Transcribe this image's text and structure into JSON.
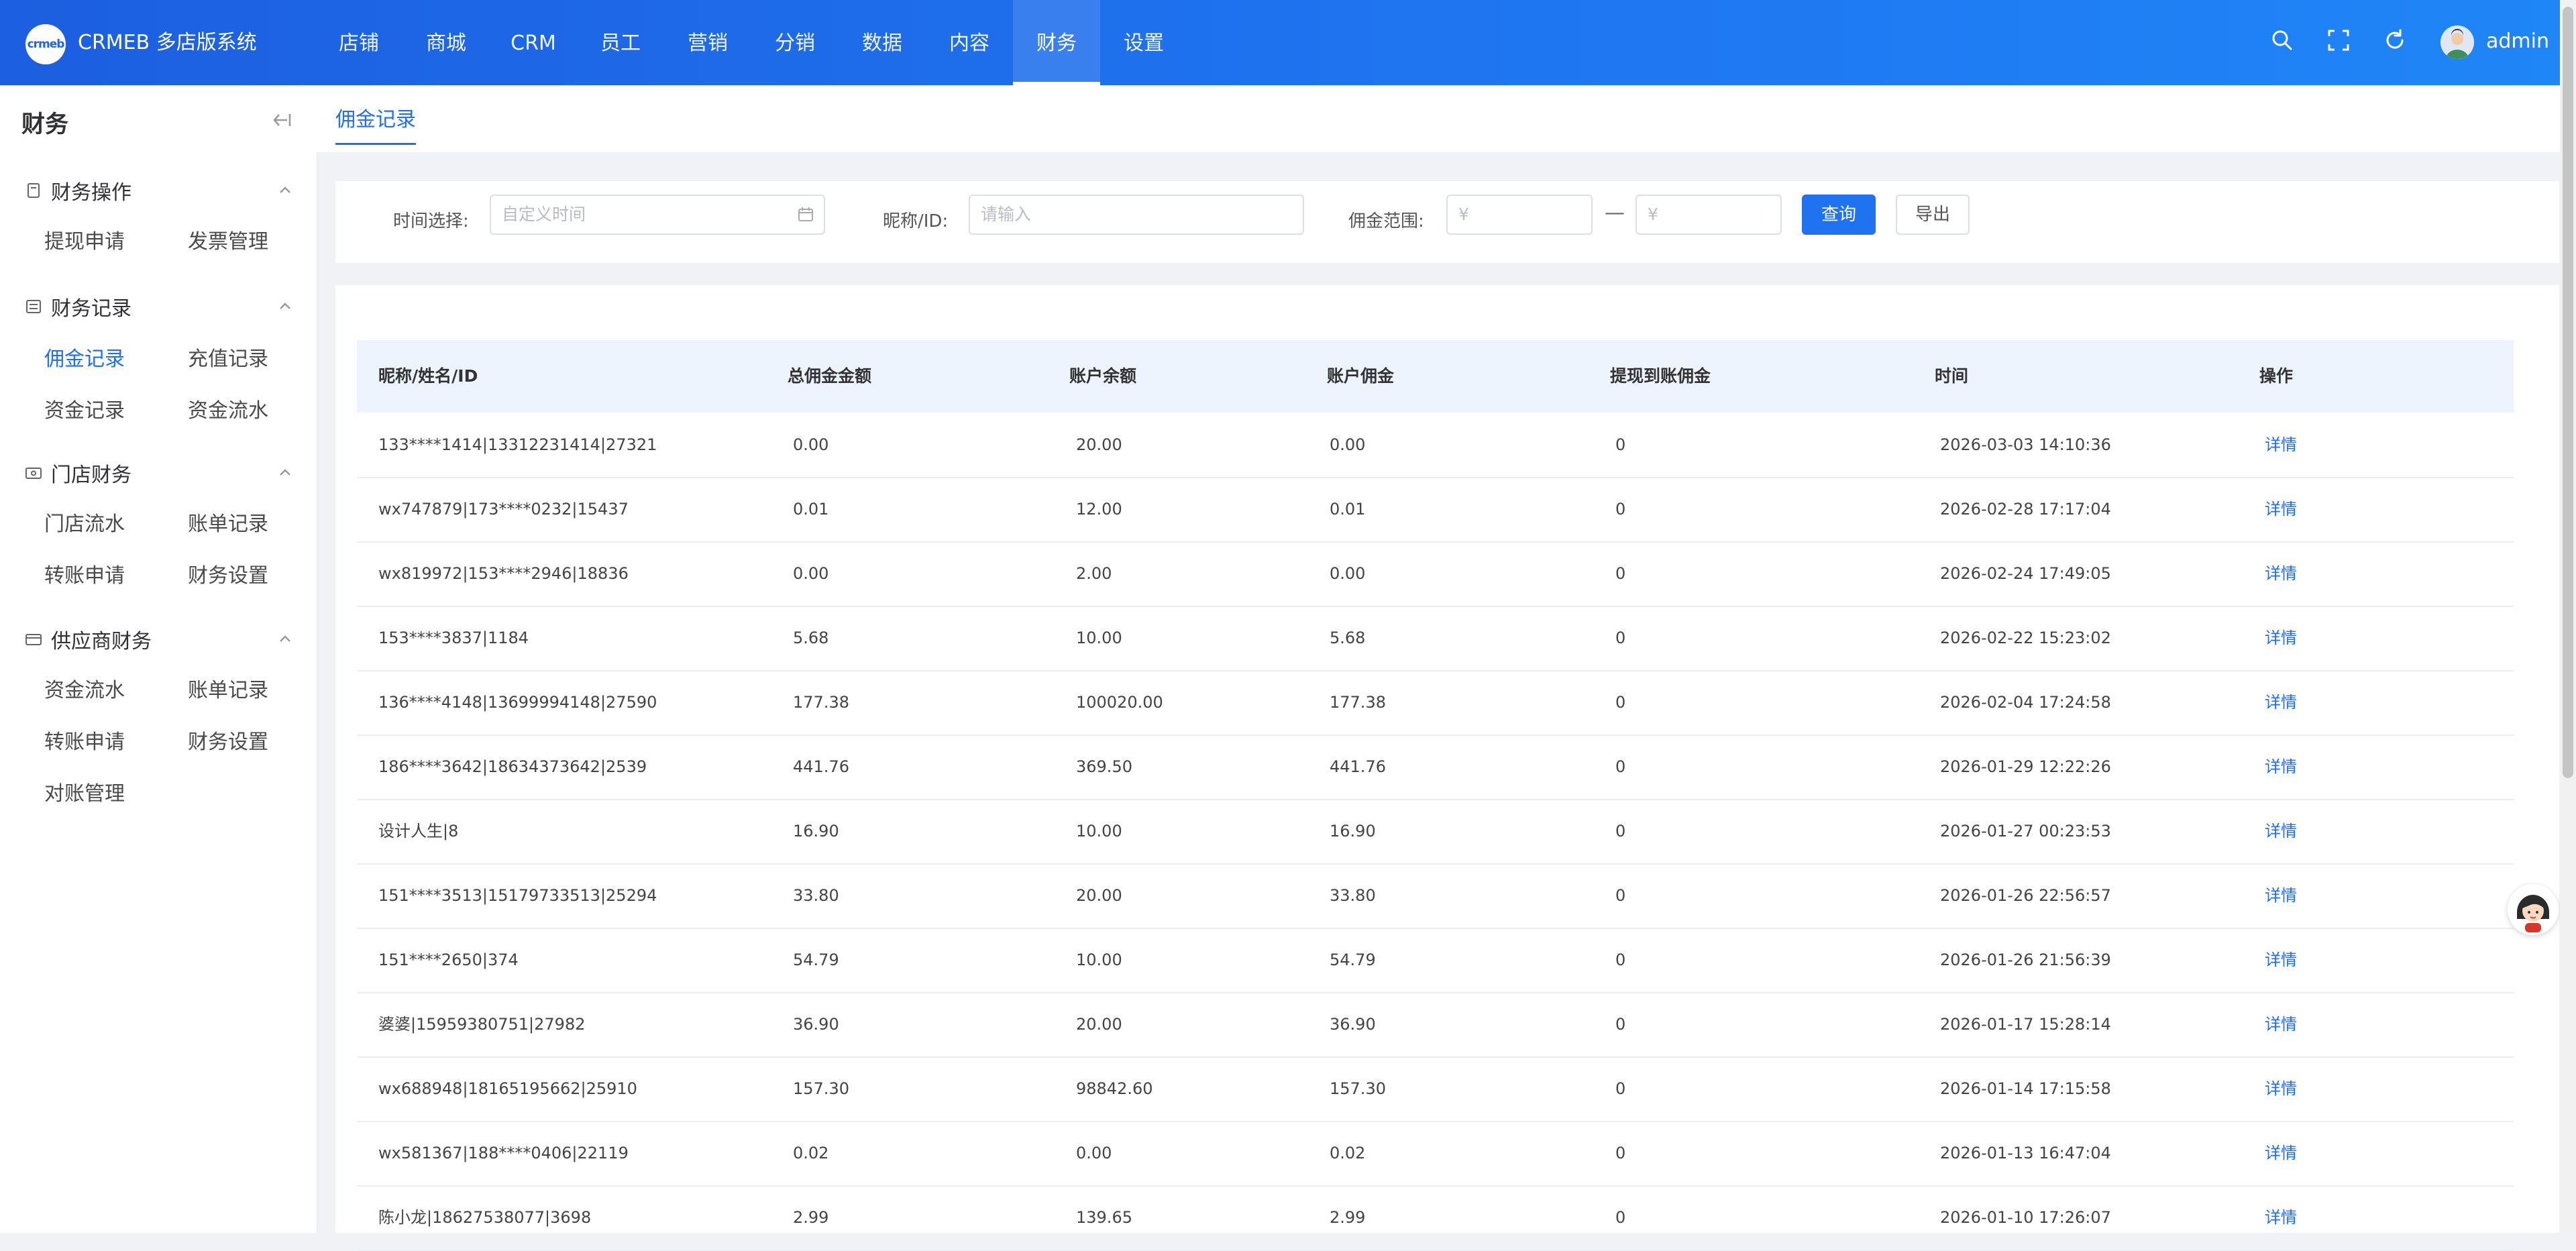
{
  "brand": {
    "logo_text": "crmeb",
    "name": "CRMEB 多店版系统"
  },
  "nav": [
    "店铺",
    "商城",
    "CRM",
    "员工",
    "营销",
    "分销",
    "数据",
    "内容",
    "财务",
    "设置"
  ],
  "nav_active": "财务",
  "user": {
    "name": "admin"
  },
  "sidebar": {
    "title": "财务",
    "groups": [
      {
        "title": "财务操作",
        "items": [
          "提现申请",
          "发票管理"
        ]
      },
      {
        "title": "财务记录",
        "items": [
          "佣金记录",
          "充值记录",
          "资金记录",
          "资金流水"
        ]
      },
      {
        "title": "门店财务",
        "items": [
          "门店流水",
          "账单记录",
          "转账申请",
          "财务设置"
        ]
      },
      {
        "title": "供应商财务",
        "items": [
          "资金流水",
          "账单记录",
          "转账申请",
          "财务设置",
          "对账管理"
        ]
      }
    ],
    "active_item": "佣金记录"
  },
  "tab": {
    "label": "佣金记录"
  },
  "filter": {
    "time_label": "时间选择:",
    "time_placeholder": "自定义时间",
    "name_label": "昵称/ID:",
    "name_placeholder": "请输入",
    "range_label": "佣金范围:",
    "min_placeholder": "¥",
    "max_placeholder": "¥",
    "range_separator": "—",
    "query_button": "查询",
    "export_button": "导出"
  },
  "table": {
    "headers": [
      "昵称/姓名/ID",
      "总佣金金额",
      "账户余额",
      "账户佣金",
      "提现到账佣金",
      "时间",
      "操作"
    ],
    "rows": [
      [
        "133****1414|13312231414|27321",
        "0.00",
        "20.00",
        "0.00",
        "0",
        "2026-03-03 14:10:36",
        "详情"
      ],
      [
        "wx747879|173****0232|15437",
        "0.01",
        "12.00",
        "0.01",
        "0",
        "2026-02-28 17:17:04",
        "详情"
      ],
      [
        "wx819972|153****2946|18836",
        "0.00",
        "2.00",
        "0.00",
        "0",
        "2026-02-24 17:49:05",
        "详情"
      ],
      [
        "153****3837|1184",
        "5.68",
        "10.00",
        "5.68",
        "0",
        "2026-02-22 15:23:02",
        "详情"
      ],
      [
        "136****4148|13699994148|27590",
        "177.38",
        "100020.00",
        "177.38",
        "0",
        "2026-02-04 17:24:58",
        "详情"
      ],
      [
        "186****3642|18634373642|2539",
        "441.76",
        "369.50",
        "441.76",
        "0",
        "2026-01-29 12:22:26",
        "详情"
      ],
      [
        "设计人生|8",
        "16.90",
        "10.00",
        "16.90",
        "0",
        "2026-01-27 00:23:53",
        "详情"
      ],
      [
        "151****3513|15179733513|25294",
        "33.80",
        "20.00",
        "33.80",
        "0",
        "2026-01-26 22:56:57",
        "详情"
      ],
      [
        "151****2650|374",
        "54.79",
        "10.00",
        "54.79",
        "0",
        "2026-01-26 21:56:39",
        "详情"
      ],
      [
        "婆婆|15959380751|27982",
        "36.90",
        "20.00",
        "36.90",
        "0",
        "2026-01-17 15:28:14",
        "详情"
      ],
      [
        "wx688948|18165195662|25910",
        "157.30",
        "98842.60",
        "157.30",
        "0",
        "2026-01-14 17:15:58",
        "详情"
      ],
      [
        "wx581367|188****0406|22119",
        "0.02",
        "0.00",
        "0.02",
        "0",
        "2026-01-13 16:47:04",
        "详情"
      ],
      [
        "陈小龙|18627538077|3698",
        "2.99",
        "139.65",
        "2.99",
        "0",
        "2026-01-10 17:26:07",
        "详情"
      ]
    ]
  },
  "colors": {
    "primary": "#1f6ff0",
    "nav_gradient_start": "#1c5fe0",
    "nav_gradient_end": "#1f86f7",
    "header_row": "#eef4fd"
  },
  "icons": [
    "search-icon",
    "fullscreen-icon",
    "refresh-icon",
    "user-avatar",
    "collapse-icon",
    "calendar-icon",
    "chevron-up-icon",
    "customer-service-avatar"
  ]
}
